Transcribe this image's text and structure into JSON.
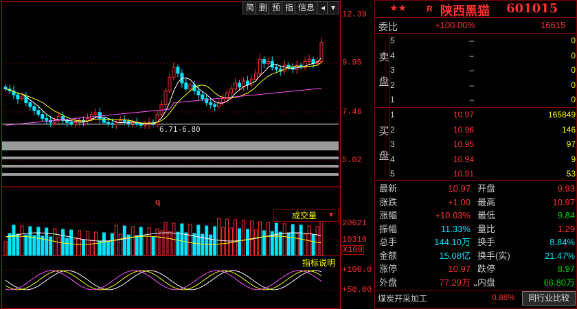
{
  "toolbar": {
    "buttons": [
      "简",
      "删",
      "预",
      "指",
      "信息"
    ],
    "arrow_left": "◂",
    "arrow_down": "▾"
  },
  "price_axis": {
    "labels": [
      "12.39",
      "9.95",
      "7.46",
      "5.02"
    ]
  },
  "annotation": {
    "range_text": "6.71-6.80",
    "marker_q": "q"
  },
  "volume_panel": {
    "title": "成交量",
    "dropdown_arrow": "▼",
    "axis_labels": [
      "20621",
      "10310"
    ],
    "unit_label": "X100"
  },
  "indicator_panel": {
    "title": "指标说明",
    "axis_labels": [
      "100.0",
      "50.00"
    ]
  },
  "header": {
    "stars": "★★",
    "r_badge": "R",
    "stock_name": "陕西黑猫",
    "stock_code": "601015"
  },
  "commission": {
    "label": "委比",
    "ratio": "+100.00%",
    "diff": "16615"
  },
  "sell_side": {
    "label_top": "卖",
    "label_bottom": "盘",
    "rows": [
      {
        "level": "5",
        "price": "–",
        "volume": "0"
      },
      {
        "level": "4",
        "price": "–",
        "volume": "0"
      },
      {
        "level": "3",
        "price": "–",
        "volume": "0"
      },
      {
        "level": "2",
        "price": "–",
        "volume": "0"
      },
      {
        "level": "1",
        "price": "–",
        "volume": "0"
      }
    ]
  },
  "buy_side": {
    "label_top": "买",
    "label_bottom": "盘",
    "rows": [
      {
        "level": "1",
        "price": "10.97",
        "volume": "165849"
      },
      {
        "level": "2",
        "price": "10.96",
        "volume": "146"
      },
      {
        "level": "3",
        "price": "10.95",
        "volume": "97"
      },
      {
        "level": "4",
        "price": "10.94",
        "volume": "9"
      },
      {
        "level": "5",
        "price": "10.91",
        "volume": "53"
      }
    ]
  },
  "quote": [
    {
      "l1": "最新",
      "v1": "10.97",
      "c1": "red",
      "l2": "开盘",
      "v2": "9.93",
      "c2": "red"
    },
    {
      "l1": "涨跌",
      "v1": "+1.00",
      "c1": "red",
      "l2": "最高",
      "v2": "10.97",
      "c2": "red"
    },
    {
      "l1": "涨幅",
      "v1": "+10.03%",
      "c1": "red",
      "l2": "最低",
      "v2": "9.84",
      "c2": "green"
    },
    {
      "l1": "振幅",
      "v1": "11.33%",
      "c1": "cyan",
      "l2": "量比",
      "v2": "1.29",
      "c2": "red"
    },
    {
      "l1": "总手",
      "v1": "144.10万",
      "c1": "cyan",
      "l2": "换手",
      "v2": "8.84%",
      "c2": "cyan"
    },
    {
      "l1": "金额",
      "v1": "15.08亿",
      "c1": "cyan",
      "l2": "换手(实)",
      "v2": "21.47%",
      "c2": "cyan"
    },
    {
      "l1": "涨停",
      "v1": "10.97",
      "c1": "red",
      "l2": "跌停",
      "v2": "8.97",
      "c2": "green"
    },
    {
      "l1": "外盘",
      "v1": "77.29万",
      "c1": "red",
      "l2": "内盘",
      "v2": "66.80万",
      "c2": "green"
    }
  ],
  "footer": {
    "more_arrow": "⌄",
    "sector": "煤炭开采加工",
    "sector_pct": "0.88%",
    "compare_button": "同行业比较"
  }
}
